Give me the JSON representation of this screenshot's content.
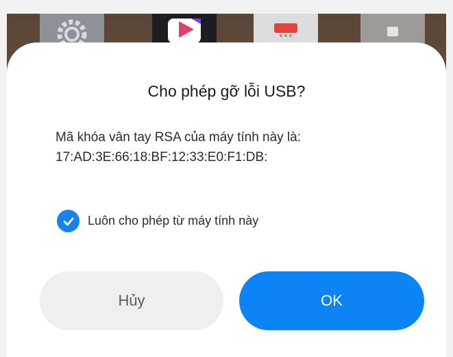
{
  "home_icons": [
    {
      "icon": "settings-gear-icon",
      "color": "#8c9298"
    },
    {
      "icon": "video-app-icon",
      "color": "#1c1c22"
    },
    {
      "icon": "store-app-icon",
      "color": "#dcdcdc"
    },
    {
      "icon": "app-icon",
      "color": "#a9a9a9"
    }
  ],
  "dialog": {
    "title": "Cho phép gỡ lỗi USB?",
    "message_line1": "Mã khóa vân tay RSA của máy tính này là:",
    "message_line2": "17:AD:3E:66:18:BF:12:33:E0:F1:DB:",
    "checkbox_label": "Luôn cho phép từ máy tính này",
    "checkbox_checked": true,
    "cancel_label": "Hủy",
    "ok_label": "OK"
  },
  "colors": {
    "accent": "#0d84f5",
    "cancel_bg": "#efefef"
  }
}
